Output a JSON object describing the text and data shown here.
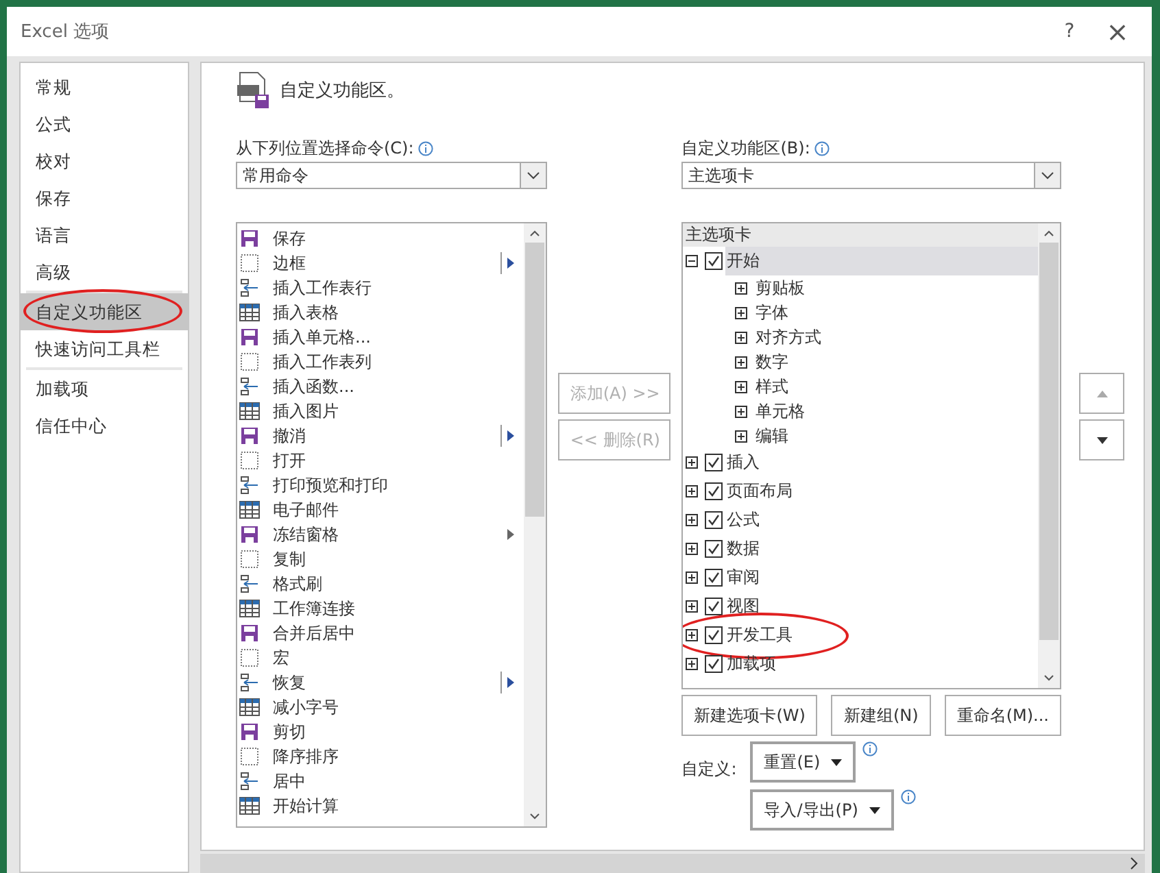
{
  "window": {
    "title": "Excel 选项",
    "help": "?",
    "close": "×"
  },
  "sidebar": {
    "groups": [
      [
        {
          "label": "常规",
          "selected": false,
          "circled": false
        },
        {
          "label": "公式",
          "selected": false,
          "circled": false
        },
        {
          "label": "校对",
          "selected": false,
          "circled": false
        },
        {
          "label": "保存",
          "selected": false,
          "circled": false
        },
        {
          "label": "语言",
          "selected": false,
          "circled": false
        },
        {
          "label": "高级",
          "selected": false,
          "circled": false
        }
      ],
      [
        {
          "label": "自定义功能区",
          "selected": true,
          "circled": true
        },
        {
          "label": "快速访问工具栏",
          "selected": false,
          "circled": false
        }
      ],
      [
        {
          "label": "加载项",
          "selected": false,
          "circled": false
        },
        {
          "label": "信任中心",
          "selected": false,
          "circled": false
        }
      ]
    ]
  },
  "heading": "自定义功能区。",
  "commands_source": {
    "label": "从下列位置选择命令(C):",
    "value": "常用命令"
  },
  "ribbon_target": {
    "label": "自定义功能区(B):",
    "value": "主选项卡"
  },
  "commands": [
    {
      "label": "保存",
      "kind": "plain"
    },
    {
      "label": "边框",
      "kind": "split"
    },
    {
      "label": "插入工作表行",
      "kind": "plain"
    },
    {
      "label": "插入表格",
      "kind": "plain"
    },
    {
      "label": "插入单元格...",
      "kind": "plain"
    },
    {
      "label": "插入工作表列",
      "kind": "plain"
    },
    {
      "label": "插入函数...",
      "kind": "plain"
    },
    {
      "label": "插入图片",
      "kind": "plain"
    },
    {
      "label": "撤消",
      "kind": "split"
    },
    {
      "label": "打开",
      "kind": "plain"
    },
    {
      "label": "打印预览和打印",
      "kind": "plain"
    },
    {
      "label": "电子邮件",
      "kind": "plain"
    },
    {
      "label": "冻结窗格",
      "kind": "arrow"
    },
    {
      "label": "复制",
      "kind": "plain"
    },
    {
      "label": "格式刷",
      "kind": "plain"
    },
    {
      "label": "工作簿连接",
      "kind": "plain"
    },
    {
      "label": "合并后居中",
      "kind": "plain"
    },
    {
      "label": "宏",
      "kind": "plain"
    },
    {
      "label": "恢复",
      "kind": "split"
    },
    {
      "label": "减小字号",
      "kind": "plain"
    },
    {
      "label": "剪切",
      "kind": "plain"
    },
    {
      "label": "降序排序",
      "kind": "plain"
    },
    {
      "label": "居中",
      "kind": "plain"
    },
    {
      "label": "开始计算",
      "kind": "plain"
    }
  ],
  "add_button": {
    "label": "添加(A) >>",
    "disabled": true
  },
  "remove_button": {
    "label": "<< 删除(R)",
    "disabled": true
  },
  "tree": {
    "header": "主选项卡",
    "items": [
      {
        "label": "开始",
        "checked": true,
        "expanded": true,
        "selected": true,
        "circled": false,
        "children": [
          {
            "label": "剪贴板"
          },
          {
            "label": "字体"
          },
          {
            "label": "对齐方式"
          },
          {
            "label": "数字"
          },
          {
            "label": "样式"
          },
          {
            "label": "单元格"
          },
          {
            "label": "编辑"
          }
        ]
      },
      {
        "label": "插入",
        "checked": true,
        "expanded": false,
        "selected": false,
        "circled": false
      },
      {
        "label": "页面布局",
        "checked": true,
        "expanded": false,
        "selected": false,
        "circled": false
      },
      {
        "label": "公式",
        "checked": true,
        "expanded": false,
        "selected": false,
        "circled": false
      },
      {
        "label": "数据",
        "checked": true,
        "expanded": false,
        "selected": false,
        "circled": false
      },
      {
        "label": "审阅",
        "checked": true,
        "expanded": false,
        "selected": false,
        "circled": false
      },
      {
        "label": "视图",
        "checked": true,
        "expanded": false,
        "selected": false,
        "circled": false
      },
      {
        "label": "开发工具",
        "checked": true,
        "expanded": false,
        "selected": false,
        "circled": true
      },
      {
        "label": "加载项",
        "checked": true,
        "expanded": false,
        "selected": false,
        "circled": false
      }
    ]
  },
  "tree_buttons": [
    "新建选项卡(W)",
    "新建组(N)",
    "重命名(M)..."
  ],
  "customize": {
    "label": "自定义:",
    "reset": "重置(E)",
    "import_export": "导入/导出(P)"
  }
}
